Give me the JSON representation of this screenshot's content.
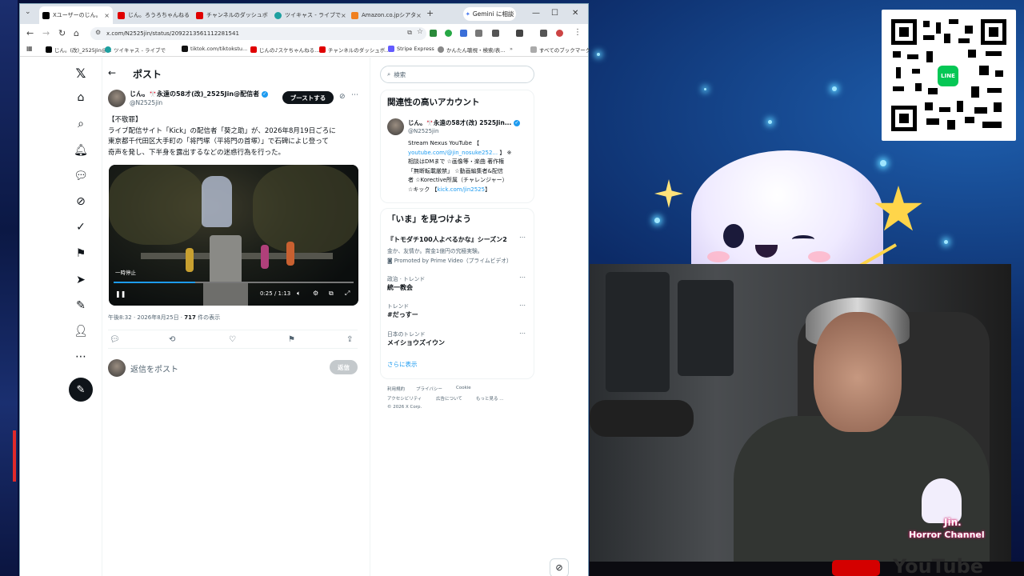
{
  "browser": {
    "tabs": [
      {
        "label": "Xユーザーのじん。",
        "color": "#000000",
        "active": true
      },
      {
        "label": "じん。ろうろちゃんねる",
        "color": "#e00000"
      },
      {
        "label": "チャンネルのダッシュボ",
        "color": "#e00000"
      },
      {
        "label": "ツイキャス - ライブで",
        "color": "#1ea0a0"
      },
      {
        "label": "Amazon.co.jpシアタ",
        "color": "#f08020"
      }
    ],
    "gemini_label": "Gemini に相談",
    "url": "x.com/N2525jin/status/2092213561112281541",
    "bookmarks": [
      "じん。(改)_2525Jin@...",
      "ツイキャス - ライブで",
      "tiktok.com/tiktokstu...",
      "じんの♪スケちゃんねる...",
      "チャンネルのダッシュボ...",
      "Stripe Express",
      "かんたん聴視・検索/表...",
      "すべてのブックマーク"
    ]
  },
  "nav": {
    "icons": [
      "x-logo-icon",
      "home-icon",
      "search-icon",
      "notifications-icon",
      "messages-icon",
      "grok-icon",
      "communities-icon",
      "bookmarks-icon",
      "jobs-icon",
      "lists-icon",
      "profile-icon",
      "more-icon"
    ],
    "post_button": "post-compose-icon"
  },
  "post": {
    "header_title": "ポスト",
    "author_name": "じん。🎌永遠の58才(改)_2525Jin@配信者",
    "author_handle": "@N2525jin",
    "boost_label": "ブーストする",
    "body_lines": [
      "【不敬罪】",
      "ライブ配信サイト「Kick」の配信者「葵之助」が、2026年8月19日ごろに",
      "東京都千代田区大手町の「将門塚（平将門の首塚）」で石碑によじ登って",
      "奇声を発し、下半身を露出するなどの迷惑行為を行った。"
    ],
    "video": {
      "paused_label": "一時停止",
      "time": "0:25 / 1:13",
      "progress": 0.34
    },
    "meta_time": "午後8:32 · 2026年8月25日 · ",
    "meta_views_count": "717",
    "meta_views_label": " 件の表示",
    "reply_placeholder": "返信をポスト",
    "reply_button": "返信"
  },
  "sidebar": {
    "search_placeholder": "検索",
    "related_title": "関連性の高いアカウント",
    "related_account": {
      "name": "じん。🎌永遠の58才(改) 2525Jin...",
      "handle": "@N2525jin",
      "bio_1": "Stream Nexus YouTube 【",
      "bio_link1": "youtube.com/@jin_nosuke252...",
      "bio_2": "】 ※",
      "bio_3": "相談はDMまで ☆画像等・楽曲 著作権",
      "bio_4": "「無断転載厳禁」 ☆動画編集者&配信",
      "bio_5": "者 ☆Korective所属（チャレンジャー）",
      "bio_6": "☆キック 【",
      "bio_link2": "kick.com/jin2525",
      "bio_7": "】"
    },
    "trends_title": "「いま」を見つけよう",
    "promo": {
      "title": "『トモダチ100人よべるかな』シーズン2",
      "sub": "金か、友情か。賞金1億円の究極実験。",
      "promoted": "Promoted by Prime Video（プライムビデオ）"
    },
    "trends": [
      {
        "category": "政治 · トレンド",
        "name": "統一教会"
      },
      {
        "category": "トレンド",
        "name": "#だっすー"
      },
      {
        "category": "日本のトレンド",
        "name": "メイショウズイウン"
      }
    ],
    "show_more": "さらに表示",
    "footer": [
      "利用規約",
      "プライバシー",
      "Cookie",
      "アクセシビリティ",
      "広告について",
      "もっと見る ...",
      "© 2026 X Corp."
    ]
  },
  "stream": {
    "qr_center_label": "LINE",
    "channel_name_1": "Jin.",
    "channel_name_2": "Horror Channel",
    "youtube_text": "YouTube"
  }
}
